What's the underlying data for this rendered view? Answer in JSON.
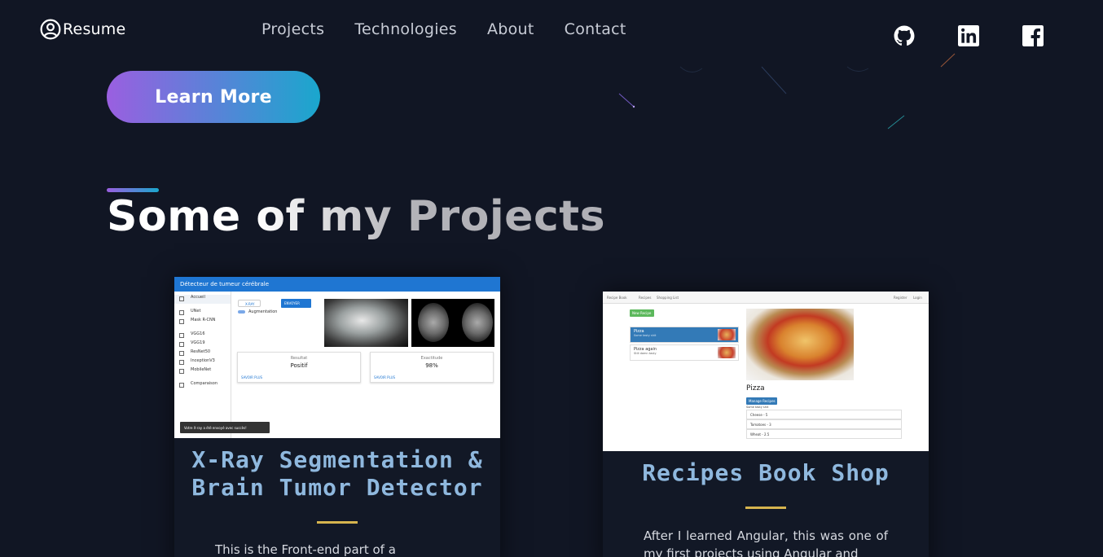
{
  "header": {
    "logo_text": "Resume",
    "nav": [
      "Projects",
      "Technologies",
      "About",
      "Contact"
    ],
    "socials": [
      "github-icon",
      "linkedin-icon",
      "facebook-icon"
    ]
  },
  "hero": {
    "cta_label": "Learn More"
  },
  "section": {
    "title": "Some of my Projects"
  },
  "projects": [
    {
      "title": "X-Ray Segmentation & Brain Tumor Detector",
      "description": "This is the Front-end part of a",
      "screenshot": {
        "app_title": "Détecteur de tumeur cérébrale",
        "menu": [
          "Accueil",
          "UNet",
          "Mask R-CNN",
          "VGG16",
          "VGG19",
          "ResNet50",
          "InceptionV3",
          "MobileNet",
          "Comparaison"
        ],
        "chip": "X-RAY",
        "toggle_label": "Augmentation",
        "send_label": "ENVOYER",
        "result_label": "Resultat",
        "result_value": "Positif",
        "accuracy_label": "Exactitude",
        "accuracy_value": "98%",
        "more_label": "SAVOIR PLUS",
        "toast": "Votre X-ray a été envoyé avec succès!"
      }
    },
    {
      "title": "Recipes Book Shop",
      "description": "After I learned Angular, this was one of my first projects using Angular and",
      "screenshot": {
        "brand": "Recipe Book",
        "tabs": [
          "Recipes",
          "Shopping List"
        ],
        "auth": [
          "Register",
          "Login"
        ],
        "new_label": "New Recipe",
        "recipes": [
          {
            "name": "Pizza",
            "desc": "Some tasty shit"
          },
          {
            "name": "Pizza again",
            "desc": "Still damn tasty"
          }
        ],
        "detail_name": "Pizza",
        "manage_label": "Manage Recipes",
        "detail_desc": "Some tasty shit",
        "ingredients": [
          "Cheese - 5",
          "Tomatoes - 3",
          "Wheat - 2.5"
        ]
      }
    }
  ],
  "colors": {
    "background": "#111624",
    "accent_start": "#9a5fe0",
    "accent_end": "#1aa7cd",
    "card_title": "#8fb8de",
    "separator": "#d6b44e"
  }
}
